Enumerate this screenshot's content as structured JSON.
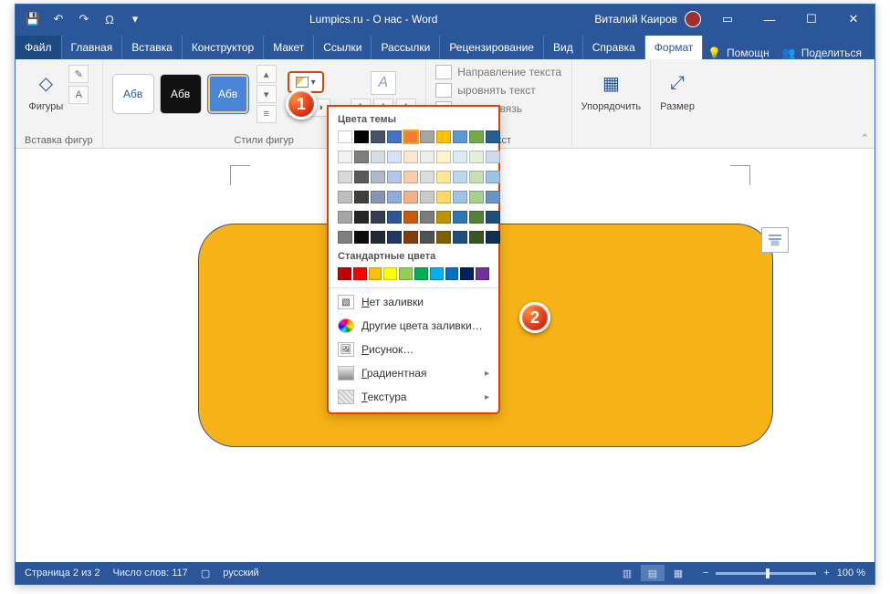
{
  "title": "Lumpics.ru - О нас  -  Word",
  "user_name": "Виталий Каиров",
  "tabs": {
    "file": "Файл",
    "home": "Главная",
    "insert": "Вставка",
    "design": "Конструктор",
    "layout": "Макет",
    "references": "Ссылки",
    "mailings": "Рассылки",
    "review": "Рецензирование",
    "view": "Вид",
    "help": "Справка",
    "format": "Формат"
  },
  "right_actions": {
    "help": "Помощн",
    "share": "Поделиться"
  },
  "ribbon": {
    "shapes_insert_label": "Фигуры",
    "shapes_insert_group": "Вставка фигур",
    "style_sample": "Абв",
    "styles_group": "Стили фигур",
    "text_direction": "Направление текста",
    "align_text": "ыровнять текст",
    "create_link": "оздать связь",
    "text_group": "Текст",
    "arrange_label": "Упорядочить",
    "size_label": "Размер"
  },
  "dropdown": {
    "theme_header": "Цвета темы",
    "standard_header": "Стандартные цвета",
    "no_fill": "Нет заливки",
    "more_colors": "Другие цвета заливки…",
    "picture": "Рисунок…",
    "gradient": "Градиентная",
    "texture": "Текстура",
    "theme_row1": [
      "#ffffff",
      "#000000",
      "#44546a",
      "#4472c4",
      "#ed7d31",
      "#a5a5a5",
      "#ffc000",
      "#5b9bd5",
      "#70ad47",
      "#255e91"
    ],
    "theme_shades": [
      [
        "#f2f2f2",
        "#7f7f7f",
        "#d6dce4",
        "#d9e2f3",
        "#fbe5d5",
        "#ededed",
        "#fff2cc",
        "#deebf6",
        "#e2efd9",
        "#cddaf0"
      ],
      [
        "#d8d8d8",
        "#595959",
        "#adb9ca",
        "#b4c6e7",
        "#f7cbac",
        "#dbdbdb",
        "#fee599",
        "#bdd7ee",
        "#c5e0b3",
        "#9cc3e5"
      ],
      [
        "#bfbfbf",
        "#3f3f3f",
        "#8496b0",
        "#8eaadb",
        "#f4b183",
        "#c9c9c9",
        "#ffd965",
        "#9cc3e5",
        "#a8d08d",
        "#6894c7"
      ],
      [
        "#a5a5a5",
        "#262626",
        "#323f4f",
        "#2f5496",
        "#c55a11",
        "#7b7b7b",
        "#bf9000",
        "#2e75b5",
        "#538135",
        "#1f4e79"
      ],
      [
        "#7f7f7f",
        "#0c0c0c",
        "#222a35",
        "#1f3864",
        "#833c0b",
        "#525252",
        "#7f6000",
        "#1e4e79",
        "#375623",
        "#10304f"
      ]
    ],
    "standard": [
      "#c00000",
      "#ff0000",
      "#ffc000",
      "#ffff00",
      "#92d050",
      "#00b050",
      "#00b0f0",
      "#0070c0",
      "#002060",
      "#7030a0"
    ],
    "selected_index": 4
  },
  "badges": {
    "one": "1",
    "two": "2"
  },
  "status": {
    "page": "Страница 2 из 2",
    "words": "Число слов: 117",
    "lang": "русский",
    "zoom": "100 %"
  }
}
